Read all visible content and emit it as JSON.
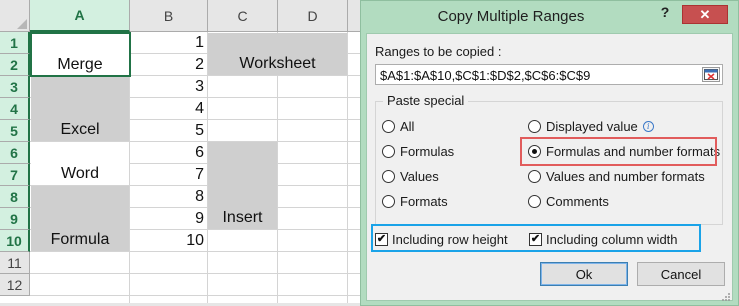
{
  "sheet": {
    "columns": [
      {
        "letter": "A",
        "selected": true
      },
      {
        "letter": "B",
        "selected": false
      },
      {
        "letter": "C",
        "selected": false
      },
      {
        "letter": "D",
        "selected": false
      }
    ],
    "rows": [
      "1",
      "2",
      "3",
      "4",
      "5",
      "6",
      "7",
      "8",
      "9",
      "10",
      "11",
      "12"
    ],
    "merged_labels": {
      "a_merge": "Merge",
      "a_excel": "Excel",
      "a_word": "Word",
      "a_formula": "Formula",
      "cd_worksheet": "Worksheet",
      "c_insert": "Insert"
    },
    "b_values": [
      "1",
      "2",
      "3",
      "4",
      "5",
      "6",
      "7",
      "8",
      "9",
      "10"
    ]
  },
  "dialog": {
    "title": "Copy Multiple Ranges",
    "help_label": "?",
    "close_label": "✕",
    "ranges_label": "Ranges to be copied :",
    "ranges_value": "$A$1:$A$10,$C$1:$D$2,$C$6:$C$9",
    "paste_special_label": "Paste special",
    "options": {
      "all": "All",
      "formulas": "Formulas",
      "values": "Values",
      "formats": "Formats",
      "displayed_value": "Displayed value",
      "formulas_and_number_formats": "Formulas and number formats",
      "values_and_number_formats": "Values and number formats",
      "comments": "Comments"
    },
    "selected_option": "formulas_and_number_formats",
    "including_row_height": "Including row height",
    "including_column_width": "Including column width",
    "row_height_checked": true,
    "column_width_checked": true,
    "check_mark": "✔",
    "ok_label": "Ok",
    "cancel_label": "Cancel"
  },
  "colors": {
    "excel_accent": "#217346",
    "dialog_frame": "#b2dcc0",
    "merged_fill": "#cfcfcf",
    "highlight_red": "#e15c5c",
    "highlight_blue": "#1aa3e8",
    "close_button": "#c75050"
  },
  "icons": [
    "corner-select-icon",
    "help-icon",
    "close-icon",
    "range-picker-icon",
    "info-icon",
    "checkmark-icon",
    "resize-grip-icon"
  ]
}
